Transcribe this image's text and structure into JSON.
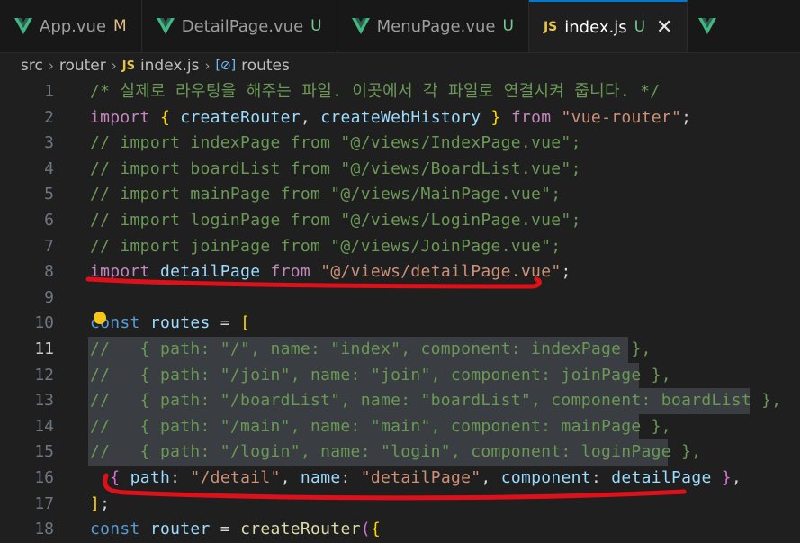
{
  "tabs": [
    {
      "label": "App.vue",
      "status": "M",
      "icon": "vue-icon"
    },
    {
      "label": "DetailPage.vue",
      "status": "U",
      "icon": "vue-icon"
    },
    {
      "label": "MenuPage.vue",
      "status": "U",
      "icon": "vue-icon"
    },
    {
      "label": "index.js",
      "status": "U",
      "icon": "js-icon",
      "active": true
    }
  ],
  "breadcrumb": {
    "items": [
      "src",
      "router",
      "index.js",
      "routes"
    ],
    "js_badge": "JS",
    "symbol_badge": "[⊘]"
  },
  "editor": {
    "current_line": 11,
    "lines": [
      {
        "n": "1",
        "text": "/* 실제로 라우팅을 해주는 파일. 이곳에서 각 파일로 연결시켜 줍니다. */"
      },
      {
        "n": "2",
        "text": "import { createRouter, createWebHistory } from \"vue-router\";"
      },
      {
        "n": "3",
        "text": "// import indexPage from \"@/views/IndexPage.vue\";"
      },
      {
        "n": "4",
        "text": "// import boardList from \"@/views/BoardList.vue\";"
      },
      {
        "n": "5",
        "text": "// import mainPage from \"@/views/MainPage.vue\";"
      },
      {
        "n": "6",
        "text": "// import loginPage from \"@/views/LoginPage.vue\";"
      },
      {
        "n": "7",
        "text": "// import joinPage from \"@/views/JoinPage.vue\";"
      },
      {
        "n": "8",
        "text": "import detailPage from \"@/views/detailPage.vue\";"
      },
      {
        "n": "9",
        "text": ""
      },
      {
        "n": "10",
        "text": "const routes = ["
      },
      {
        "n": "11",
        "text": "//   { path: \"/\", name: \"index\", component: indexPage },"
      },
      {
        "n": "12",
        "text": "//   { path: \"/join\", name: \"join\", component: joinPage },"
      },
      {
        "n": "13",
        "text": "//   { path: \"/boardList\", name: \"boardList\", component: boardList },"
      },
      {
        "n": "14",
        "text": "//   { path: \"/main\", name: \"main\", component: mainPage },"
      },
      {
        "n": "15",
        "text": "//   { path: \"/login\", name: \"login\", component: loginPage },"
      },
      {
        "n": "16",
        "text": "  { path: \"/detail\", name: \"detailPage\", component: detailPage },"
      },
      {
        "n": "17",
        "text": "];"
      },
      {
        "n": "18",
        "text": "const router = createRouter({"
      }
    ]
  },
  "colors": {
    "background": "#1f1f1f",
    "comment": "#6a9955",
    "keyword": "#c586c0",
    "variable": "#9cdcfe",
    "string": "#ce9178",
    "annotation": "#e0101a"
  }
}
